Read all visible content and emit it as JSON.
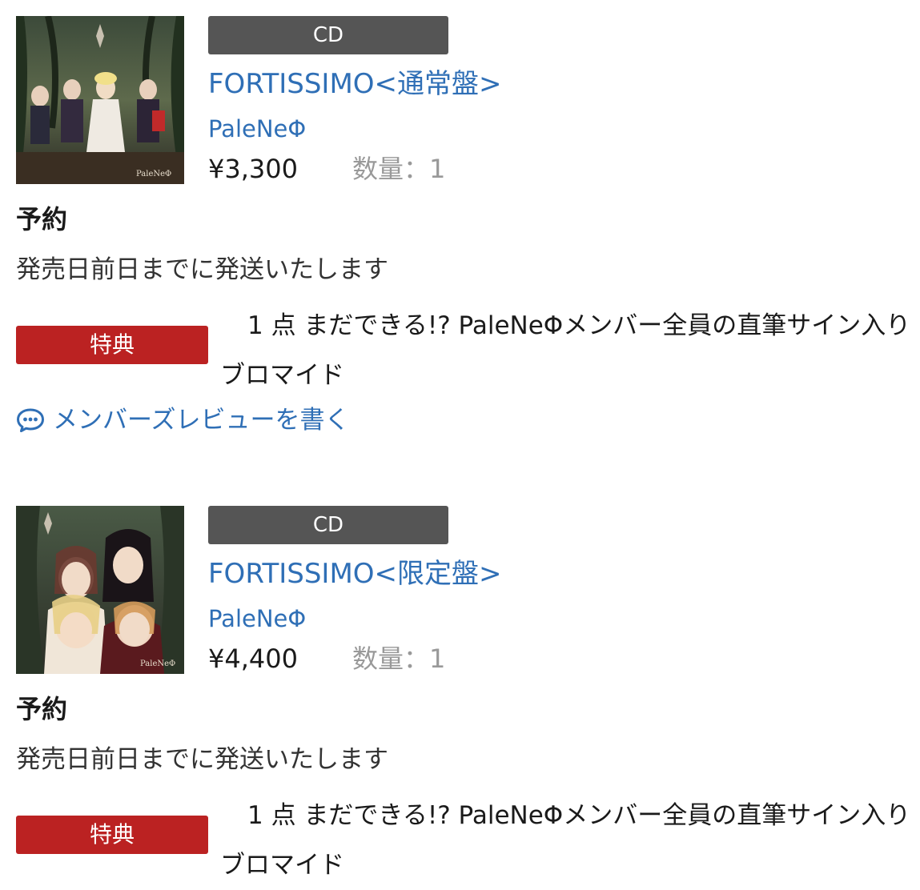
{
  "items": [
    {
      "format": "CD",
      "title": "FORTISSIMO<通常盤>",
      "artist": "PaleNeΦ",
      "price": "¥3,300",
      "quantity": "数量：1",
      "status": "予約",
      "shipping": "発売日前日までに発送いたします",
      "bonus_label": "特典",
      "bonus_count": "1 点",
      "bonus_desc": "まだできる!? PaleNeΦメンバー全員の直筆サイン入りブロマイド",
      "review_link": "メンバーズレビューを書く"
    },
    {
      "format": "CD",
      "title": "FORTISSIMO<限定盤>",
      "artist": "PaleNeΦ",
      "price": "¥4,400",
      "quantity": "数量：1",
      "status": "予約",
      "shipping": "発売日前日までに発送いたします",
      "bonus_label": "特典",
      "bonus_count": "1 点",
      "bonus_desc": "まだできる!? PaleNeΦメンバー全員の直筆サイン入りブロマイド"
    }
  ],
  "colors": {
    "link": "#2f6fb6",
    "format_badge": "#555555",
    "bonus_badge": "#bb2222",
    "muted": "#999999"
  },
  "icons": {
    "review": "speech-bubble-icon"
  }
}
